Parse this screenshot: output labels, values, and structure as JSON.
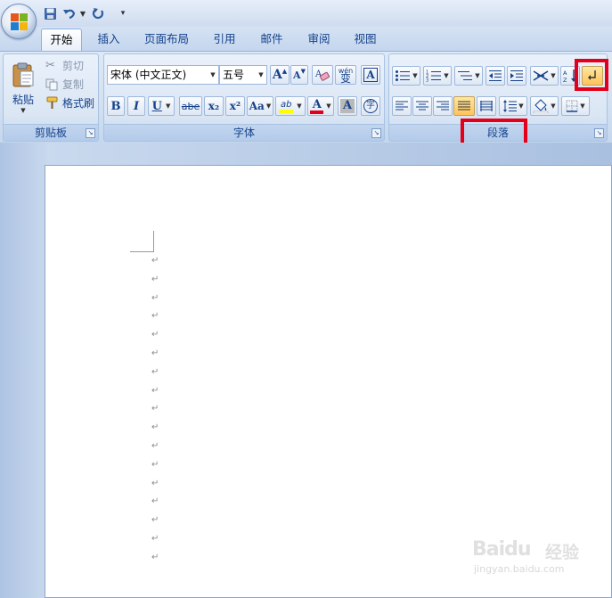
{
  "tabs": [
    {
      "label": "开始",
      "active": true
    },
    {
      "label": "插入"
    },
    {
      "label": "页面布局"
    },
    {
      "label": "引用"
    },
    {
      "label": "邮件"
    },
    {
      "label": "审阅"
    },
    {
      "label": "视图"
    }
  ],
  "clipboard": {
    "group_label": "剪贴板",
    "paste": "粘贴",
    "cut": "剪切",
    "copy": "复制",
    "format_painter": "格式刷"
  },
  "font": {
    "group_label": "字体",
    "font_name": "宋体 (中文正文)",
    "font_size": "五号",
    "bold": "B",
    "italic": "I",
    "underline": "U",
    "strikethrough": "abe",
    "subscript": "x₂",
    "superscript": "x²",
    "change_case": "Aa",
    "grow_font": "A",
    "shrink_font": "A",
    "phonetic_guide": "wén",
    "phonetic_char": "变",
    "char_border": "A",
    "highlight_text": "ab",
    "font_color": "A",
    "char_shading": "A",
    "enclose_char": "字"
  },
  "paragraph": {
    "group_label": "段落"
  },
  "document": {
    "paragraph_mark": "↵",
    "paragraph_count": 17
  },
  "colors": {
    "highlight_box": "#e4001b",
    "ribbon_text": "#15428b",
    "font_color_bar": "#e4001b",
    "highlight_color_bar": "#ffff00"
  },
  "watermark": {
    "brand": "Baidu",
    "brand_cn": "经验",
    "url": "jingyan.baidu.com"
  }
}
